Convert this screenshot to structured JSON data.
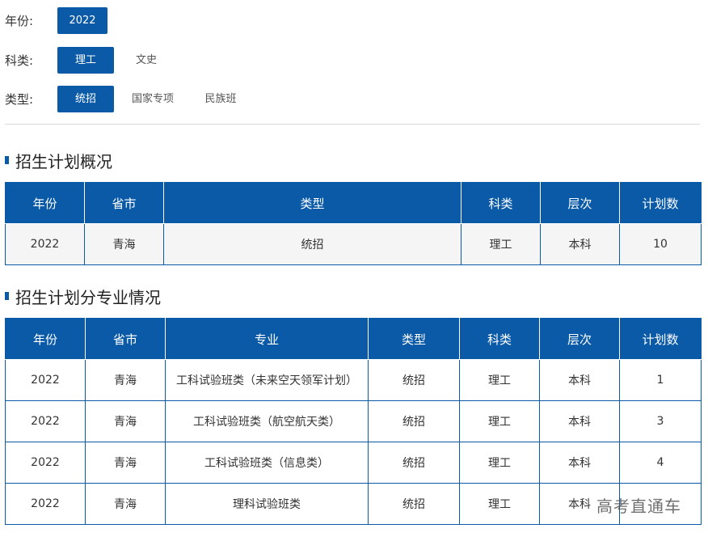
{
  "filters": {
    "year": {
      "label": "年份:",
      "options": [
        "2022"
      ],
      "active": "2022"
    },
    "subject": {
      "label": "科类:",
      "options": [
        "理工",
        "文史"
      ],
      "active": "理工"
    },
    "type": {
      "label": "类型:",
      "options": [
        "统招",
        "国家专项",
        "民族班"
      ],
      "active": "统招"
    }
  },
  "overview": {
    "title": "招生计划概况",
    "headers": [
      "年份",
      "省市",
      "类型",
      "科类",
      "层次",
      "计划数"
    ],
    "rows": [
      [
        "2022",
        "青海",
        "统招",
        "理工",
        "本科",
        "10"
      ]
    ]
  },
  "by_major": {
    "title": "招生计划分专业情况",
    "headers": [
      "年份",
      "省市",
      "专业",
      "类型",
      "科类",
      "层次",
      "计划数"
    ],
    "rows": [
      [
        "2022",
        "青海",
        "工科试验班类（未来空天领军计划）",
        "统招",
        "理工",
        "本科",
        "1"
      ],
      [
        "2022",
        "青海",
        "工科试验班类（航空航天类）",
        "统招",
        "理工",
        "本科",
        "3"
      ],
      [
        "2022",
        "青海",
        "工科试验班类（信息类）",
        "统招",
        "理工",
        "本科",
        "4"
      ],
      [
        "2022",
        "青海",
        "理科试验班类",
        "统招",
        "理工",
        "本科",
        ""
      ]
    ]
  },
  "watermark": "高考直通车",
  "colors": {
    "accent": "#0a5aa8",
    "overview_row_bg": "#f5f5f5"
  }
}
